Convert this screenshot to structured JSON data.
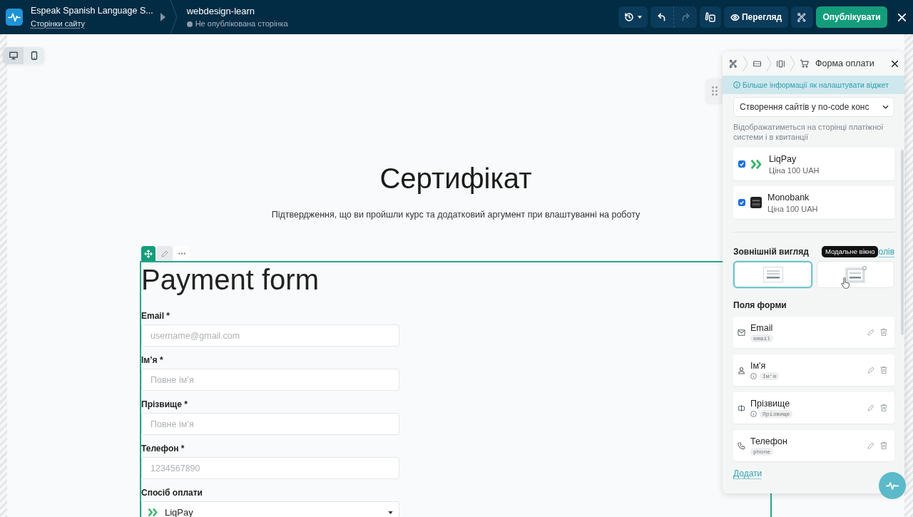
{
  "top_bar": {
    "site_name": "Espeak Spanish Language S...",
    "site_pages_link": "Сторінки сайту",
    "page_name": "webdesign-learn",
    "page_status": "Не опублікована сторінка",
    "undo": {
      "disabled": false
    },
    "redo": {
      "disabled": true
    },
    "preview_button": "Перегляд",
    "publish_button": "Опублікувати"
  },
  "device_toggle": [
    {
      "kind": "desktop",
      "selected": true
    },
    {
      "kind": "mobile",
      "selected": false
    }
  ],
  "page": {
    "heading": "Сертифікат",
    "subtitle": "Підтвердження, що ви пройшли курс та додатковий аргумент при влаштуванні на роботу",
    "payment_widget": {
      "title": "Payment form",
      "fields": [
        {
          "label": "Email *",
          "placeholder": "username@gmail.com"
        },
        {
          "label": "Ім’я *",
          "placeholder": "Повне ім’я"
        },
        {
          "label": "Прізвище *",
          "placeholder": "Повне ім’я"
        },
        {
          "label": "Телефон *",
          "placeholder": "1234567890"
        }
      ],
      "payment_method": {
        "label": "Спосіб оплати",
        "kind": "liqpay",
        "value": "LiqPay"
      }
    }
  },
  "settings_panel": {
    "title": "Форма оплати",
    "info_link": "Більше інформації як налаштувати віджет",
    "purpose_select": {
      "value": "Створення сайтів у no-code конс"
    },
    "purpose_hint": "Відображатиметься на сторінці платіжної системи і в квитанції",
    "payment_systems": [
      {
        "kind": "liqpay",
        "name": "LiqPay",
        "price": "Ціна 100 UAH",
        "checked": true
      },
      {
        "kind": "monobank",
        "name": "Monobank",
        "price": "Ціна 100 UAH",
        "checked": true
      }
    ],
    "appearance": {
      "title": "Зовнішній вигляд",
      "link": "олів",
      "tooltip": "Модальне вікно",
      "options": [
        {
          "kind": "inline",
          "selected": true
        },
        {
          "kind": "modal",
          "selected": false
        }
      ]
    },
    "form_fields": {
      "title": "Поля форми",
      "items": [
        {
          "kind": "email",
          "name": "Email",
          "key": "email",
          "info_icon": false
        },
        {
          "kind": "person",
          "name": "Ім'я",
          "key": "Ім'я",
          "info_icon": true
        },
        {
          "kind": "surname",
          "name": "Прізвище",
          "key": "Прізвище",
          "info_icon": true
        },
        {
          "kind": "phone",
          "name": "Телефон",
          "key": "phone",
          "info_icon": false
        }
      ],
      "add_link": "Додати"
    }
  }
}
